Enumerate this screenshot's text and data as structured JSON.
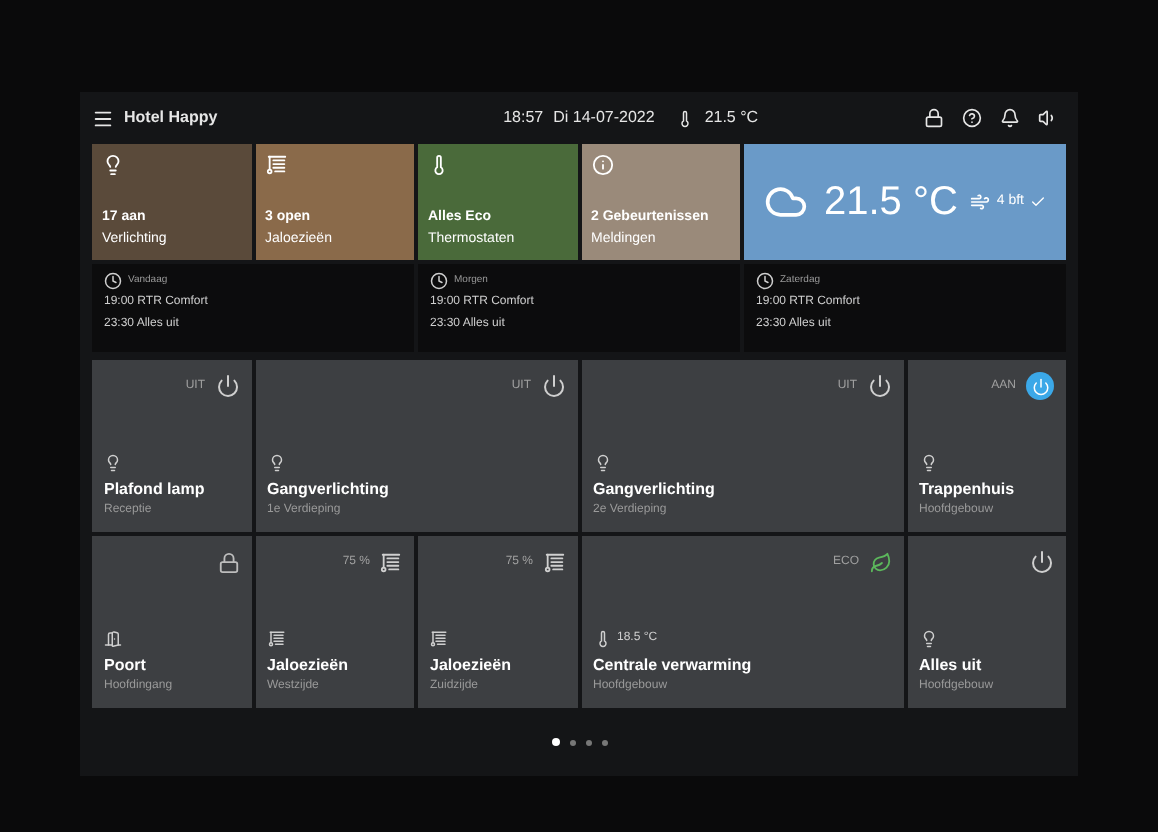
{
  "header": {
    "title": "Hotel Happy",
    "time": "18:57",
    "date": "Di 14-07-2022",
    "temperature": "21.5 °C"
  },
  "summary_tiles": [
    {
      "kind": "light",
      "value": "17 aan",
      "label": "Verlichting"
    },
    {
      "kind": "blind",
      "value": "3 open",
      "label": "Jaloezieën"
    },
    {
      "kind": "thermostat",
      "value": "Alles Eco",
      "label": "Thermostaten"
    },
    {
      "kind": "alert",
      "value": "2 Gebeurtenissen",
      "label": "Meldingen"
    },
    {
      "kind": "weather",
      "value": "21.5 °C",
      "label": "4 bft"
    }
  ],
  "schedules": [
    {
      "day": "Vandaag",
      "entries": [
        "19:00 RTR Comfort",
        "23:30 Alles uit"
      ]
    },
    {
      "day": "Morgen",
      "entries": [
        "19:00 RTR Comfort",
        "23:30 Alles uit"
      ]
    },
    {
      "day": "Zaterdag",
      "entries": [
        "19:00 RTR Comfort",
        "23:30 Alles uit"
      ]
    }
  ],
  "devices": [
    {
      "kind": "light",
      "wide": false,
      "name": "Plafond lamp",
      "location": "Receptie",
      "status": "UIT",
      "on": false
    },
    {
      "kind": "light",
      "wide": true,
      "name": "Gangverlichting",
      "location": "1e Verdieping",
      "status": "UIT",
      "on": false
    },
    {
      "kind": "light",
      "wide": true,
      "name": "Gangverlichting",
      "location": "2e Verdieping",
      "status": "UIT",
      "on": false
    },
    {
      "kind": "light",
      "wide": false,
      "name": "Trappenhuis",
      "location": "Hoofdgebouw",
      "status": "AAN",
      "on": true
    },
    {
      "kind": "door",
      "wide": false,
      "name": "Poort",
      "location": "Hoofdingang"
    },
    {
      "kind": "blind",
      "wide": false,
      "name": "Jaloezieën",
      "location": "Westzijde",
      "status": "75 %"
    },
    {
      "kind": "blind",
      "wide": false,
      "name": "Jaloezieën",
      "location": "Zuidzijde",
      "status": "75 %"
    },
    {
      "kind": "heating",
      "wide": true,
      "name": "Centrale verwarming",
      "location": "Hoofdgebouw",
      "reading": "18.5 °C",
      "status": "ECO"
    },
    {
      "kind": "light",
      "wide": false,
      "name": "Alles uit",
      "location": "Hoofdgebouw",
      "on": false
    }
  ],
  "pages": [
    {
      "selected": true
    },
    {
      "selected": false
    },
    {
      "selected": false
    },
    {
      "selected": false
    }
  ]
}
